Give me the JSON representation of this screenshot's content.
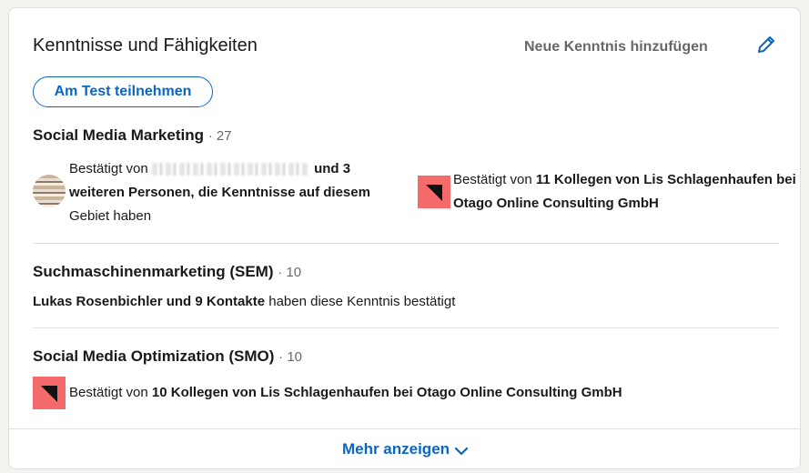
{
  "header": {
    "title": "Kenntnisse und Fähigkeiten",
    "add_skill_label": "Neue Kenntnis hinzufügen",
    "edit_icon": "pencil-icon"
  },
  "test_button_label": "Am Test teilnehmen",
  "skills": [
    {
      "name": "Social Media Marketing",
      "count": "· 27",
      "endorsement_left": {
        "prefix": "Bestätigt von ",
        "bold": "und 3 weiteren Personen, die Kenntnisse auf diesem",
        "suffix": "Gebiet haben"
      },
      "endorsement_right": {
        "prefix": "Bestätigt von ",
        "bold": "11 Kollegen von Lis Schlagenhaufen bei Otago Online Consulting GmbH"
      }
    },
    {
      "name": "Suchmaschinenmarketing (SEM)",
      "count": "· 10",
      "endorsement": {
        "bold": "Lukas Rosenbichler und 9 Kontakte",
        "suffix": " haben diese Kenntnis bestätigt"
      }
    },
    {
      "name": "Social Media Optimization (SMO)",
      "count": "· 10",
      "endorsement": {
        "prefix": "Bestätigt von ",
        "bold": "10 Kollegen von Lis Schlagenhaufen bei Otago Online Consulting GmbH"
      }
    }
  ],
  "footer": {
    "more_label": "Mehr anzeigen",
    "more_icon": "chevron-down-icon"
  },
  "colors": {
    "accent": "#0a66c2",
    "company_logo": "#f56b6b",
    "divider": "#e0dfdc"
  }
}
